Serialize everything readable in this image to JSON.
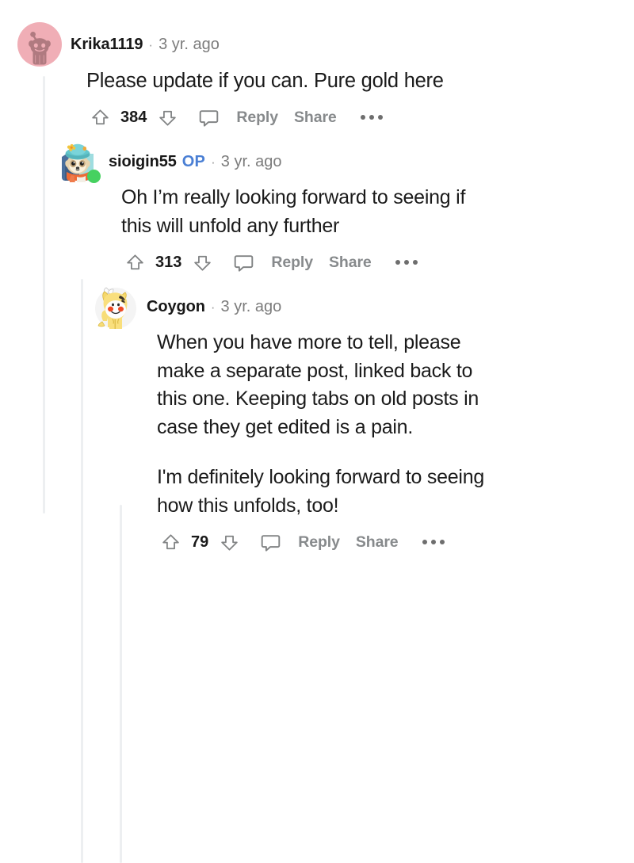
{
  "theme": {
    "accent_blue": "#4a7fd4",
    "online_green": "#46d160",
    "muted_gray": "#878a8c",
    "thread_line": "#edeff1",
    "text": "#1a1a1b"
  },
  "actions": {
    "upvote_icon": "upvote-arrow-icon",
    "downvote_icon": "downvote-arrow-icon",
    "comment_icon": "comment-bubble-icon",
    "reply_label": "Reply",
    "share_label": "Share",
    "more_icon": "more-options-icon"
  },
  "comments": [
    {
      "depth": 0,
      "username": "Krika1119",
      "is_op": false,
      "op_label": "",
      "separator": "·",
      "timestamp": "3 yr. ago",
      "avatar": "snoo-default-pink-avatar",
      "online": false,
      "paragraphs": [
        "Please update if you can. Pure gold here"
      ],
      "vote_count": "384"
    },
    {
      "depth": 1,
      "username": "sioigin55",
      "is_op": true,
      "op_label": "OP",
      "separator": "·",
      "timestamp": "3 yr. ago",
      "avatar": "snoo-sloth-teal-hat-avatar",
      "online": true,
      "paragraphs": [
        "Oh I’m really looking forward to seeing if this will unfold any further"
      ],
      "vote_count": "313"
    },
    {
      "depth": 2,
      "username": "Coygon",
      "is_op": false,
      "op_label": "",
      "separator": "·",
      "timestamp": "3 yr. ago",
      "avatar": "snoo-yellow-fox-hoodie-avatar",
      "online": false,
      "paragraphs": [
        "When you have more to tell, please make a separate post, linked back to this one. Keeping tabs on old posts in case they get edited is a pain.",
        "I'm definitely looking forward to seeing how this unfolds, too!"
      ],
      "vote_count": "79"
    }
  ]
}
